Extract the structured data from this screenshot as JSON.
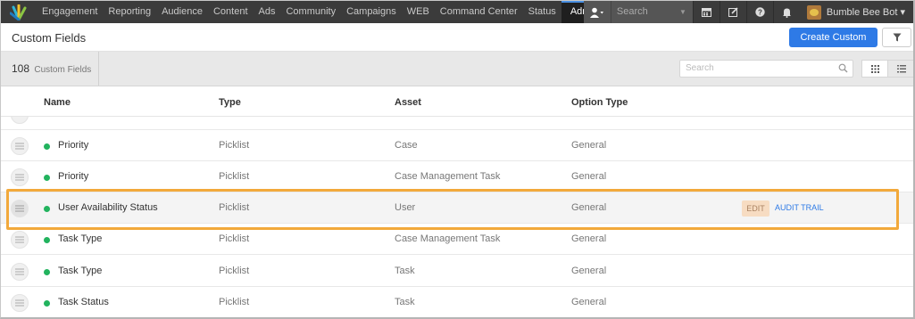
{
  "topnav": {
    "items": [
      "Engagement",
      "Reporting",
      "Audience",
      "Content",
      "Ads",
      "Community",
      "Campaigns",
      "WEB",
      "Command Center",
      "Status",
      "Administration"
    ],
    "active": "Administration",
    "search_placeholder": "Search",
    "user_name": "Bumble Bee Bot",
    "user_caret": "▾"
  },
  "header": {
    "title": "Custom Fields",
    "create_button": "Create Custom Field"
  },
  "toolbar": {
    "count": "108",
    "count_label": "Custom Fields",
    "search_placeholder": "Search"
  },
  "table": {
    "columns": [
      "Name",
      "Type",
      "Asset",
      "Option Type"
    ],
    "rows": [
      {
        "name": "Priority",
        "type": "Picklist",
        "asset": "Case",
        "option_type": "General"
      },
      {
        "name": "Priority",
        "type": "Picklist",
        "asset": "Case Management Task",
        "option_type": "General"
      },
      {
        "name": "User Availability Status",
        "type": "Picklist",
        "asset": "User",
        "option_type": "General",
        "highlighted": true
      },
      {
        "name": "Task Type",
        "type": "Picklist",
        "asset": "Case Management Task",
        "option_type": "General"
      },
      {
        "name": "Task Type",
        "type": "Picklist",
        "asset": "Task",
        "option_type": "General"
      },
      {
        "name": "Task Status",
        "type": "Picklist",
        "asset": "Task",
        "option_type": "General"
      }
    ],
    "row_actions": {
      "edit": "EDIT",
      "audit": "AUDIT TRAIL"
    }
  },
  "colors": {
    "nav_bg": "#3b3b3b",
    "accent": "#2e7ae6",
    "status_active": "#22b35e",
    "highlight_outline": "#f2a93b"
  },
  "icons": [
    "sprinklr-logo-icon",
    "user-icon",
    "calendar-icon",
    "compose-icon",
    "help-icon",
    "bell-icon",
    "filter-icon",
    "search-icon",
    "grid-view-icon",
    "list-view-icon",
    "drag-handle-icon"
  ]
}
